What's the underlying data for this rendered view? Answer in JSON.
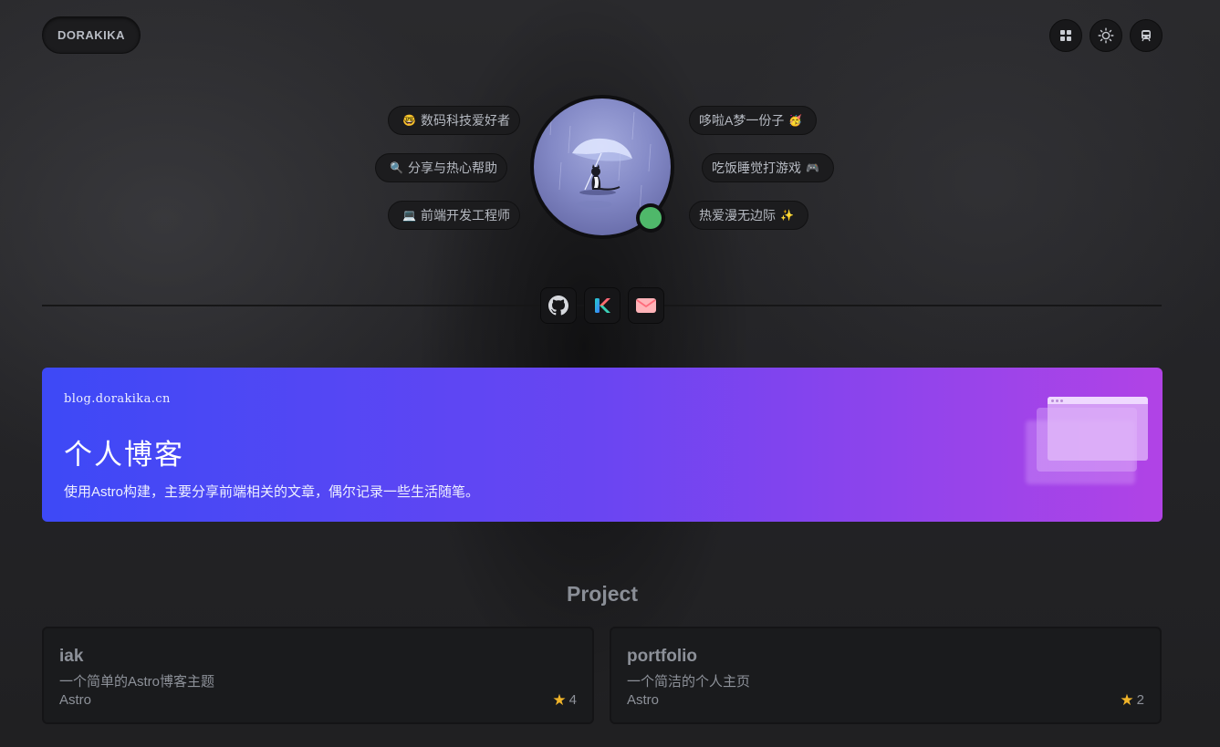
{
  "header": {
    "brand": "DORAKIKA",
    "buttons": [
      {
        "icon": "grid-icon"
      },
      {
        "icon": "sun-icon"
      },
      {
        "icon": "train-icon"
      }
    ]
  },
  "profile": {
    "left_tags": [
      {
        "emoji": "🤓",
        "label": "数码科技爱好者"
      },
      {
        "emoji": "🔍",
        "label": "分享与热心帮助"
      },
      {
        "emoji": "💻",
        "label": "前端开发工程师"
      }
    ],
    "right_tags": [
      {
        "emoji": "🥳",
        "label": "哆啦A梦一份子"
      },
      {
        "emoji": "🎮",
        "label": "吃饭睡觉打游戏"
      },
      {
        "emoji": "✨",
        "label": "热爱漫无边际"
      }
    ],
    "avatar": "cat-with-umbrella-in-rain",
    "status_color": "#4fb86a"
  },
  "social": [
    {
      "icon": "github-icon"
    },
    {
      "icon": "kotlin-k-icon"
    },
    {
      "icon": "mail-icon"
    }
  ],
  "blog": {
    "url": "blog.dorakika.cn",
    "title": "个人博客",
    "description": "使用Astro构建，主要分享前端相关的文章，偶尔记录一些生活随笔。",
    "gradient": [
      "#3d49f6",
      "#b143e6"
    ]
  },
  "projects": {
    "title": "Project",
    "items": [
      {
        "name": "iak",
        "description": "一个简单的Astro博客主题",
        "language": "Astro",
        "stars": "4"
      },
      {
        "name": "portfolio",
        "description": "一个简洁的个人主页",
        "language": "Astro",
        "stars": "2"
      }
    ]
  }
}
